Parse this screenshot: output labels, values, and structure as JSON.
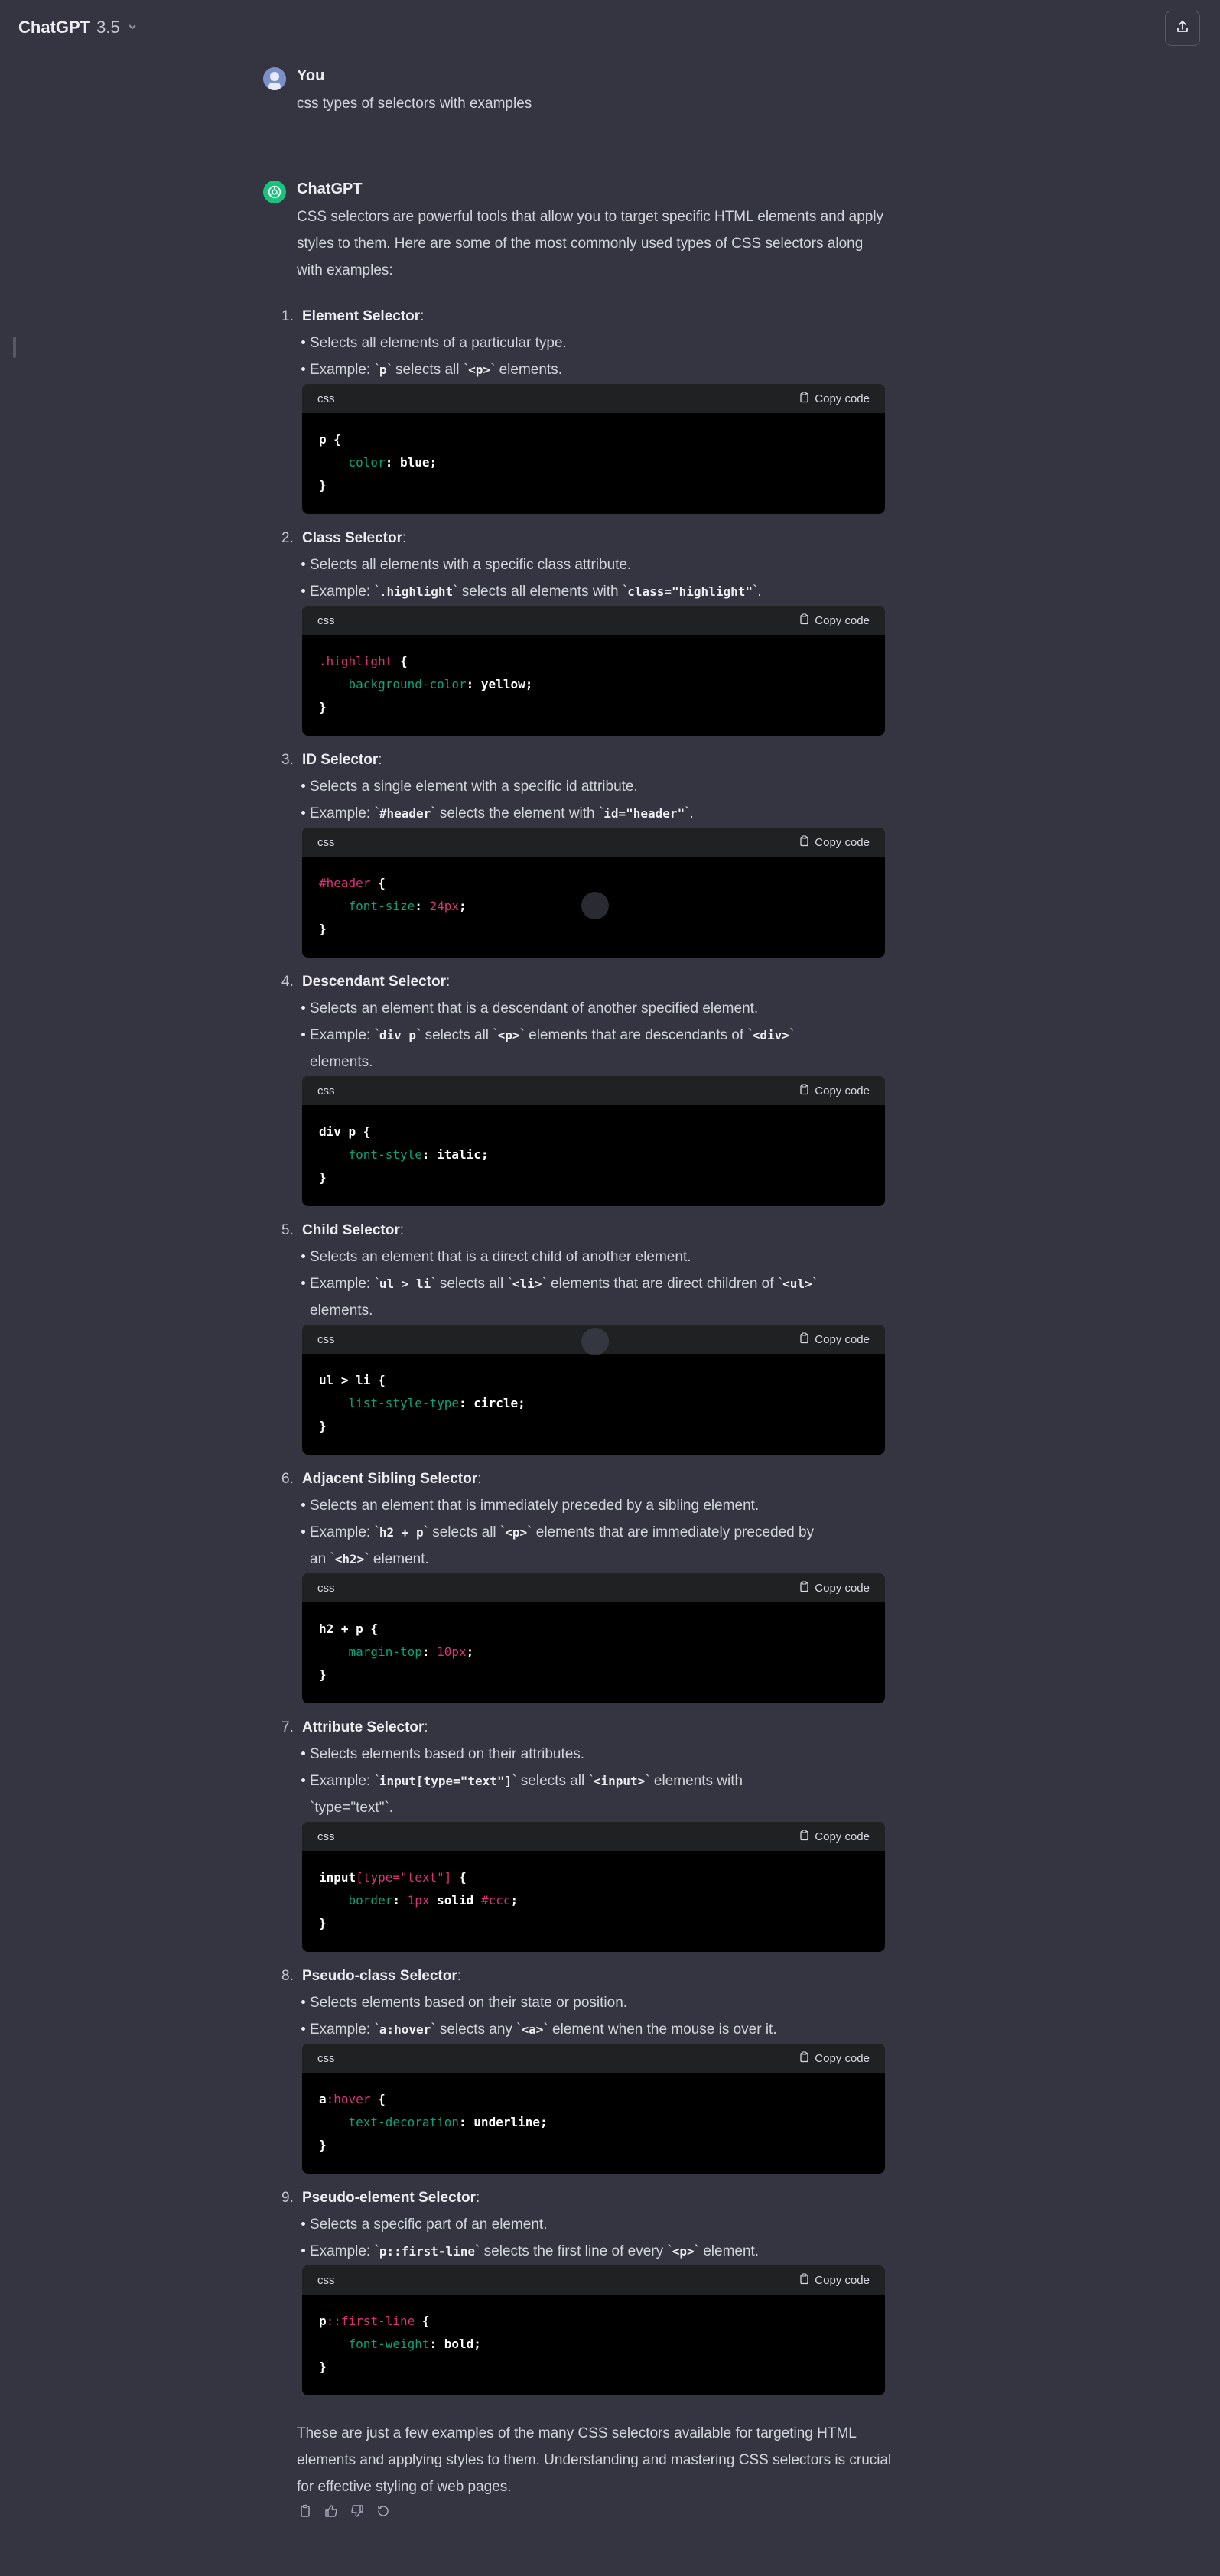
{
  "header": {
    "model_name": "ChatGPT",
    "model_version": "3.5"
  },
  "user_message": {
    "author": "You",
    "text": "css types of selectors with examples"
  },
  "assistant_message": {
    "author": "ChatGPT",
    "intro": "CSS selectors are powerful tools that allow you to target specific HTML elements and apply styles to them. Here are some of the most commonly used types of CSS selectors along with examples:",
    "copy_label": "Copy code",
    "items": [
      {
        "num": "1.",
        "title": "Element Selector",
        "colon": ":",
        "desc": "Selects all elements of a particular type.",
        "ex": [
          "Example: `",
          "p",
          "` selects all `",
          "<p>",
          "` elements."
        ],
        "lang": "css",
        "code": [
          [
            "p {"
          ],
          [
            "    ",
            "color",
            ": ",
            "blue",
            ";"
          ],
          [
            "}"
          ]
        ]
      },
      {
        "num": "2.",
        "title": "Class Selector",
        "colon": ":",
        "desc": "Selects all elements with a specific class attribute.",
        "ex": [
          "Example: `",
          ".highlight",
          "` selects all elements with `",
          "class=\"highlight\"",
          "`."
        ],
        "lang": "css",
        "code": [
          [
            ".highlight",
            " {"
          ],
          [
            "    ",
            "background-color",
            ": ",
            "yellow",
            ";"
          ],
          [
            "}"
          ]
        ]
      },
      {
        "num": "3.",
        "title": "ID Selector",
        "colon": ":",
        "desc": "Selects a single element with a specific id attribute.",
        "ex": [
          "Example: `",
          "#header",
          "` selects the element with `",
          "id=\"header\"",
          "`."
        ],
        "lang": "css",
        "code": [
          [
            "#header",
            " {"
          ],
          [
            "    ",
            "font-size",
            ": ",
            "24px",
            ";"
          ],
          [
            "}"
          ]
        ]
      },
      {
        "num": "4.",
        "title": "Descendant Selector",
        "colon": ":",
        "desc": "Selects an element that is a descendant of another specified element.",
        "ex": [
          "Example: `",
          "div p",
          "` selects all `",
          "<p>",
          "` elements that are descendants of `",
          "<div>",
          "`",
          "elements."
        ],
        "lang": "css",
        "code": [
          [
            "div p {"
          ],
          [
            "    ",
            "font-style",
            ": ",
            "italic",
            ";"
          ],
          [
            "}"
          ]
        ]
      },
      {
        "num": "5.",
        "title": "Child Selector",
        "colon": ":",
        "desc": "Selects an element that is a direct child of another element.",
        "ex": [
          "Example: `",
          "ul > li",
          "` selects all `",
          "<li>",
          "` elements that are direct children of `",
          "<ul>",
          "`",
          "elements."
        ],
        "lang": "css",
        "code": [
          [
            "ul > li {"
          ],
          [
            "    ",
            "list-style-type",
            ": ",
            "circle",
            ";"
          ],
          [
            "}"
          ]
        ]
      },
      {
        "num": "6.",
        "title": "Adjacent Sibling Selector",
        "colon": ":",
        "desc": "Selects an element that is immediately preceded by a sibling element.",
        "ex": [
          "Example: `",
          "h2 + p",
          "` selects all `",
          "<p>",
          "` elements that are immediately preceded by",
          "an `",
          "<h2>",
          "` element."
        ],
        "lang": "css",
        "code": [
          [
            "h2 + p {"
          ],
          [
            "    ",
            "margin-top",
            ": ",
            "10px",
            ";"
          ],
          [
            "}"
          ]
        ]
      },
      {
        "num": "7.",
        "title": "Attribute Selector",
        "colon": ":",
        "desc": "Selects elements based on their attributes.",
        "ex": [
          "Example: `",
          "input[type=\"text\"]",
          "` selects all `",
          "<input>",
          "` elements with",
          "`",
          "type=\"text\"",
          "`."
        ],
        "lang": "css",
        "code": [
          [
            "input",
            "[type=\"text\"]",
            " {"
          ],
          [
            "    ",
            "border",
            ": ",
            "1px",
            " solid ",
            "#ccc",
            ";"
          ],
          [
            "}"
          ]
        ]
      },
      {
        "num": "8.",
        "title": "Pseudo-class Selector",
        "colon": ":",
        "desc": "Selects elements based on their state or position.",
        "ex": [
          "Example: `",
          "a:hover",
          "` selects any `",
          "<a>",
          "` element when the mouse is over it."
        ],
        "lang": "css",
        "code": [
          [
            "a",
            ":hover",
            " {"
          ],
          [
            "    ",
            "text-decoration",
            ": ",
            "underline",
            ";"
          ],
          [
            "}"
          ]
        ]
      },
      {
        "num": "9.",
        "title": "Pseudo-element Selector",
        "colon": ":",
        "desc": "Selects a specific part of an element.",
        "ex": [
          "Example: `",
          "p::first-line",
          "` selects the first line of every `",
          "<p>",
          "` element."
        ],
        "lang": "css",
        "code": [
          [
            "p",
            "::first-line",
            " {"
          ],
          [
            "    ",
            "font-weight",
            ": ",
            "bold",
            ";"
          ],
          [
            "}"
          ]
        ]
      }
    ],
    "closing": "These are just a few examples of the many CSS selectors available for targeting HTML elements and applying styles to them. Understanding and mastering CSS selectors is crucial for effective styling of web pages."
  },
  "icons": {
    "chevron": "chevron-down-icon",
    "share": "share-icon",
    "copy": "clipboard-icon",
    "thumbs_up": "thumbs-up-icon",
    "thumbs_down": "thumbs-down-icon",
    "regenerate": "regenerate-icon"
  },
  "colors": {
    "background": "#343541",
    "code_bg": "#000000",
    "code_header": "#202123",
    "accent": "#19c37d",
    "selector_pink": "#df3079",
    "property_green": "#00a67d"
  }
}
